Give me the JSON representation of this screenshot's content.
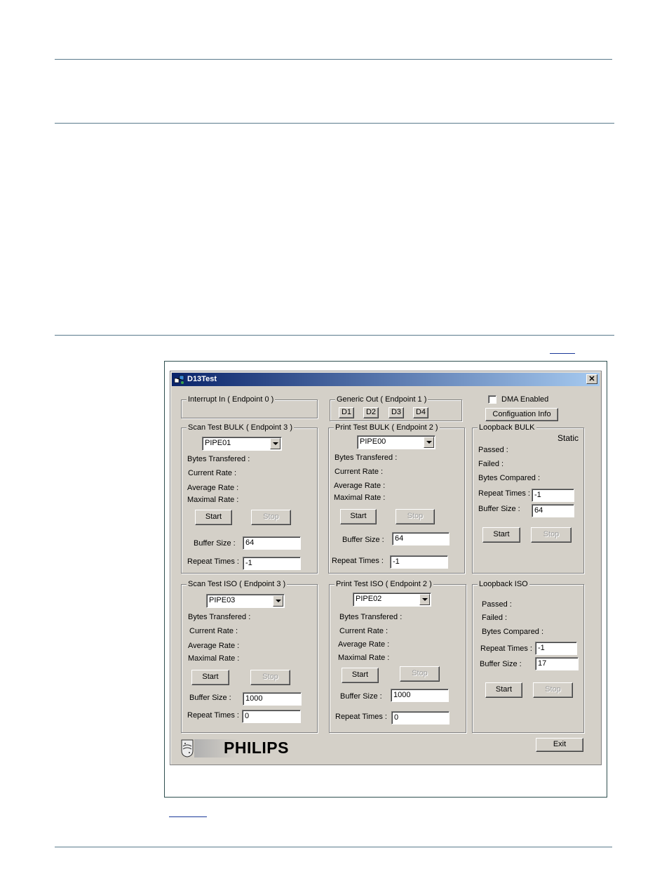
{
  "window": {
    "title": "D13Test",
    "close": "✕"
  },
  "dma": {
    "label": "DMA Enabled",
    "config_button": "Configuation Info"
  },
  "interrupt_in": {
    "legend": "Interrupt In ( Endpoint 0 )"
  },
  "generic_out": {
    "legend": "Generic Out ( Endpoint 1 )",
    "buttons": [
      "D1",
      "D2",
      "D3",
      "D4"
    ]
  },
  "scan_bulk": {
    "legend": "Scan Test BULK ( Endpoint 3 )",
    "pipe": "PIPE01",
    "bytes": "Bytes Transfered :",
    "current": "Current Rate :",
    "average": "Average Rate :",
    "maximal": "Maximal Rate :",
    "start": "Start",
    "stop": "Stop",
    "buffer_label": "Buffer Size :",
    "buffer_value": "64",
    "repeat_label": "Repeat Times :",
    "repeat_value": "-1"
  },
  "print_bulk": {
    "legend": "Print Test BULK ( Endpoint 2 )",
    "pipe": "PIPE00",
    "bytes": "Bytes Transfered :",
    "current": "Current Rate :",
    "average": "Average Rate :",
    "maximal": "Maximal Rate :",
    "start": "Start",
    "stop": "Stop",
    "buffer_label": "Buffer Size :",
    "buffer_value": "64",
    "repeat_label": "Repeat Times :",
    "repeat_value": "-1"
  },
  "loop_bulk": {
    "legend": "Loopback BULK",
    "status": "Static",
    "passed": "Passed :",
    "failed": "Failed :",
    "compared": "Bytes Compared :",
    "repeat_label": "Repeat Times :",
    "repeat_value": "-1",
    "buffer_label": "Buffer Size :",
    "buffer_value": "64",
    "start": "Start",
    "stop": "Stop"
  },
  "scan_iso": {
    "legend": "Scan Test ISO ( Endpoint 3 )",
    "pipe": "PIPE03",
    "bytes": "Bytes Transfered :",
    "current": "Current Rate :",
    "average": "Average Rate :",
    "maximal": "Maximal Rate :",
    "start": "Start",
    "stop": "Stop",
    "buffer_label": "Buffer Size :",
    "buffer_value": "1000",
    "repeat_label": "Repeat Times :",
    "repeat_value": "0"
  },
  "print_iso": {
    "legend": "Print Test ISO ( Endpoint 2 )",
    "pipe": "PIPE02",
    "bytes": "Bytes Transfered :",
    "current": "Current Rate :",
    "average": "Average Rate :",
    "maximal": "Maximal Rate :",
    "start": "Start",
    "stop": "Stop",
    "buffer_label": "Buffer Size :",
    "buffer_value": "1000",
    "repeat_label": "Repeat Times :",
    "repeat_value": "0"
  },
  "loop_iso": {
    "legend": "Loopback ISO",
    "passed": "Passed :",
    "failed": "Failed :",
    "compared": "Bytes Compared :",
    "repeat_label": "Repeat Times :",
    "repeat_value": "-1",
    "buffer_label": "Buffer Size :",
    "buffer_value": "17",
    "start": "Start",
    "stop": "Stop"
  },
  "logo": {
    "text": "PHILIPS"
  },
  "exit": "Exit"
}
